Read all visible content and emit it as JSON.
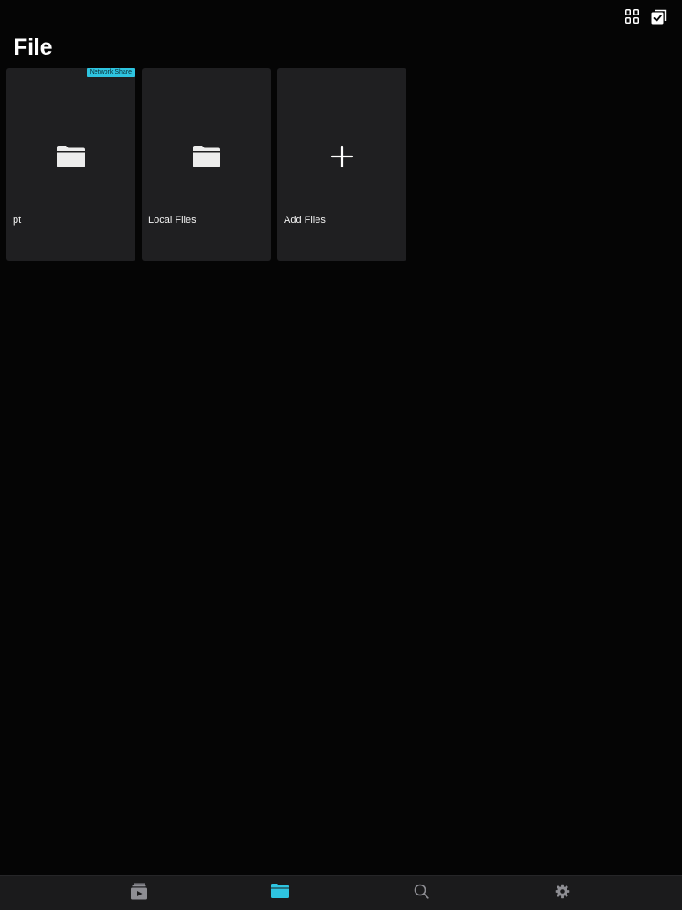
{
  "header": {
    "title": "File",
    "actions": [
      {
        "icon": "grid-view-icon"
      },
      {
        "icon": "select-checkbox-icon"
      }
    ]
  },
  "tiles": [
    {
      "label": "pt",
      "icon": "folder-icon",
      "badge": "Network Share"
    },
    {
      "label": "Local Files",
      "icon": "folder-icon"
    },
    {
      "label": "Add Files",
      "icon": "plus-icon"
    }
  ],
  "tabbar": {
    "active_index": 1,
    "items": [
      {
        "icon": "media-playlist-icon"
      },
      {
        "icon": "folder-icon"
      },
      {
        "icon": "search-icon"
      },
      {
        "icon": "settings-gear-icon"
      }
    ]
  },
  "colors": {
    "background": "#050505",
    "tile": "#1f1f21",
    "accent": "#2ec4e0",
    "tabbar": "#1b1b1c",
    "inactive_icon": "#8e8e93"
  }
}
